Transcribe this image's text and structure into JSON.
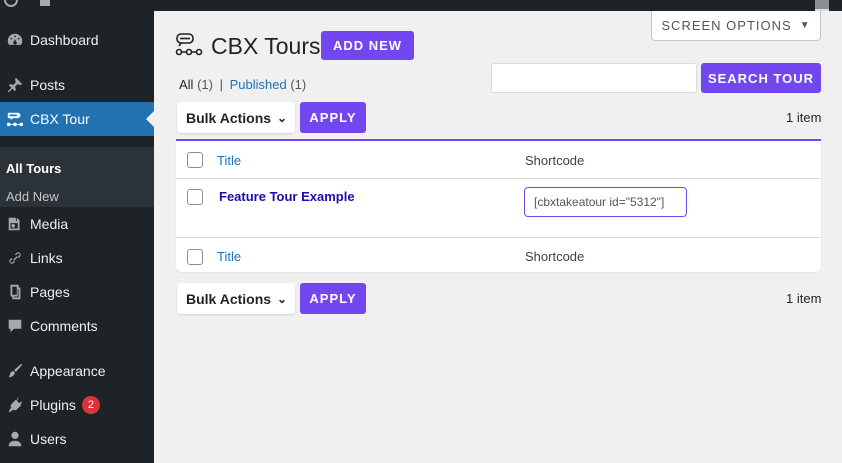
{
  "sidebar": {
    "items": [
      {
        "label": "Dashboard",
        "icon": "dashboard-icon"
      },
      {
        "label": "Posts",
        "icon": "pin-icon"
      },
      {
        "label": "CBX Tour",
        "icon": "tour-icon"
      },
      {
        "label": "Media",
        "icon": "media-icon"
      },
      {
        "label": "Links",
        "icon": "link-icon"
      },
      {
        "label": "Pages",
        "icon": "pages-icon"
      },
      {
        "label": "Comments",
        "icon": "comment-icon"
      },
      {
        "label": "Appearance",
        "icon": "brush-icon"
      },
      {
        "label": "Plugins",
        "icon": "plug-icon",
        "badge": "2"
      },
      {
        "label": "Users",
        "icon": "user-icon"
      }
    ],
    "submenu": [
      {
        "label": "All Tours"
      },
      {
        "label": "Add New"
      }
    ]
  },
  "header": {
    "screen_options": "SCREEN OPTIONS",
    "title": "CBX Tours",
    "add_new": "ADD NEW"
  },
  "views": {
    "all": "All",
    "all_count": "(1)",
    "sep": "|",
    "published": "Published",
    "published_count": "(1)"
  },
  "search": {
    "button": "SEARCH TOUR",
    "value": ""
  },
  "tablenav": {
    "bulk": "Bulk Actions",
    "apply": "APPLY",
    "count": "1 item"
  },
  "table": {
    "columns": [
      "Title",
      "Shortcode"
    ],
    "rows": [
      {
        "title": "Feature Tour Example",
        "shortcode": "[cbxtakeatour id=\"5312\"]"
      }
    ]
  },
  "colors": {
    "accent": "#7247f0",
    "sidebar": "#1d2327",
    "active": "#2271b1"
  }
}
